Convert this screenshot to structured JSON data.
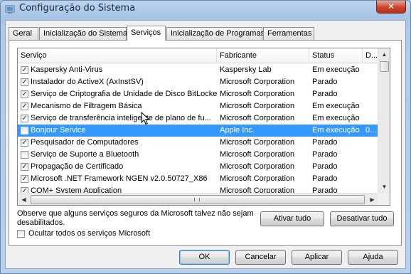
{
  "window": {
    "title": "Configuração do Sistema",
    "close_glyph": "✕"
  },
  "tabs": [
    {
      "label": "Geral",
      "active": false
    },
    {
      "label": "Inicialização do Sistema",
      "active": false
    },
    {
      "label": "Serviços",
      "active": true
    },
    {
      "label": "Inicialização de Programas",
      "active": false
    },
    {
      "label": "Ferramentas",
      "active": false
    }
  ],
  "columns": {
    "service": "Serviço",
    "manufacturer": "Fabricante",
    "status": "Status",
    "date": "D..."
  },
  "services": [
    {
      "checked": true,
      "name": "Kaspersky Anti-Virus",
      "manufacturer": "Kaspersky Lab",
      "status": "Em execução",
      "date": "",
      "selected": false
    },
    {
      "checked": true,
      "name": "Instalador do ActiveX (AxInstSV)",
      "manufacturer": "Microsoft Corporation",
      "status": "Parado",
      "date": "",
      "selected": false
    },
    {
      "checked": true,
      "name": "Serviço de Criptografia de Unidade de Disco BitLocker",
      "manufacturer": "Microsoft Corporation",
      "status": "Parado",
      "date": "",
      "selected": false
    },
    {
      "checked": true,
      "name": "Mecanismo de Filtragem Básica",
      "manufacturer": "Microsoft Corporation",
      "status": "Em execução",
      "date": "",
      "selected": false
    },
    {
      "checked": true,
      "name": "Serviço de transferência inteligente de plano de fu...",
      "manufacturer": "Microsoft Corporation",
      "status": "Em execução",
      "date": "",
      "selected": false
    },
    {
      "checked": false,
      "name": "Bonjour Service",
      "manufacturer": "Apple Inc.",
      "status": "Em execução",
      "date": "0...",
      "selected": true
    },
    {
      "checked": true,
      "name": "Pesquisador de Computadores",
      "manufacturer": "Microsoft Corporation",
      "status": "Parado",
      "date": "",
      "selected": false
    },
    {
      "checked": false,
      "name": "Serviço de Suporte a Bluetooth",
      "manufacturer": "Microsoft Corporation",
      "status": "Parado",
      "date": "",
      "selected": false
    },
    {
      "checked": true,
      "name": "Propagação de Certificado",
      "manufacturer": "Microsoft Corporation",
      "status": "Parado",
      "date": "",
      "selected": false
    },
    {
      "checked": true,
      "name": "Microsoft .NET Framework NGEN v2.0.50727_X86",
      "manufacturer": "Microsoft Corporation",
      "status": "Parado",
      "date": "",
      "selected": false
    },
    {
      "checked": true,
      "name": "COM+ System Application",
      "manufacturer": "Microsoft Corporation",
      "status": "Parado",
      "date": "",
      "selected": false
    }
  ],
  "note": "Observe que alguns serviços seguros da Microsoft talvez não sejam desabilitados.",
  "buttons": {
    "enable_all": "Ativar tudo",
    "disable_all": "Desativar tudo",
    "ok": "OK",
    "cancel": "Cancelar",
    "apply": "Aplicar",
    "help": "Ajuda"
  },
  "hide_ms": {
    "label": "Ocultar todos os serviços Microsoft",
    "checked": false
  },
  "colors": {
    "selection": "#3399ff",
    "title_bar": "#a6c3e6",
    "close_button": "#c9442a"
  }
}
